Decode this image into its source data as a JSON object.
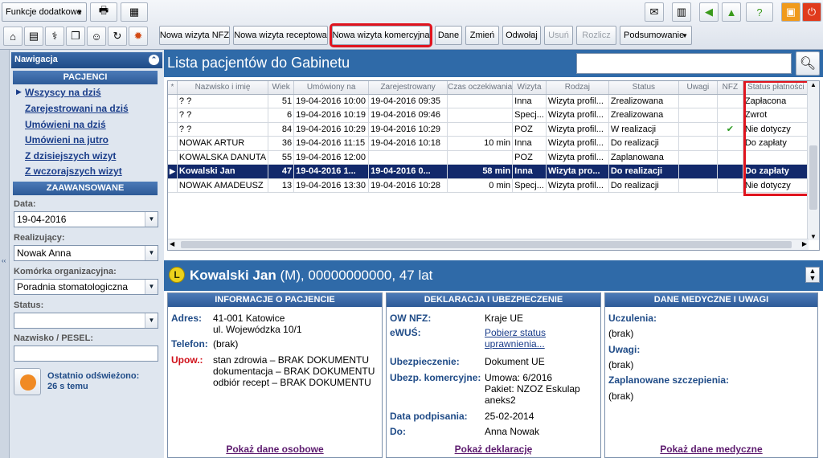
{
  "toolbar": {
    "dropdown_label": "Funkcje dodatkowe",
    "buttons": {
      "nowa_nfz": "Nowa wizyta NFZ",
      "nowa_receptowa": "Nowa wizyta receptowa",
      "nowa_komercyjna": "Nowa wizyta komercyjna",
      "dane": "Dane",
      "zmien": "Zmień",
      "odwolaj": "Odwołaj",
      "usun": "Usuń",
      "rozlicz": "Rozlicz",
      "podsumowanie": "Podsumowanie"
    }
  },
  "nav": {
    "title": "Nawigacja",
    "section_patients": "PACJENCI",
    "links": [
      "Wszyscy na dziś",
      "Zarejestrowani na dziś",
      "Umówieni na dziś",
      "Umówieni na jutro",
      "Z dzisiejszych wizyt",
      "Z wczorajszych wizyt"
    ],
    "section_advanced": "ZAAWANSOWANE",
    "date_label": "Data:",
    "date_value": "19-04-2016",
    "realizer_label": "Realizujący:",
    "realizer_value": "Nowak Anna",
    "unit_label": "Komórka organizacyjna:",
    "unit_value": "Poradnia stomatologiczna",
    "status_label": "Status:",
    "status_value": "",
    "name_label": "Nazwisko / PESEL:",
    "name_value": "",
    "refresh_line1": "Ostatnio odświeżono:",
    "refresh_line2": "26 s temu"
  },
  "list": {
    "title": "Lista pacjentów do Gabinetu",
    "columns": [
      "Nazwisko i imię",
      "Wiek",
      "Umówiony na",
      "Zarejestrowany",
      "Czas oczekiwania",
      "Wizyta",
      "Rodzaj",
      "Status",
      "Uwagi",
      "NFZ",
      "Status płatności"
    ],
    "rows": [
      {
        "name": "? ?",
        "age": "51",
        "appt": "19-04-2016 10:00",
        "reg": "19-04-2016 09:35",
        "wait": "",
        "visit": "Inna",
        "kind": "Wizyta profil...",
        "status": "Zrealizowana",
        "notes": "",
        "nfz": "",
        "pay": "Zapłacona"
      },
      {
        "name": "? ?",
        "age": "6",
        "appt": "19-04-2016 10:19",
        "reg": "19-04-2016 09:46",
        "wait": "",
        "visit": "Specj...",
        "kind": "Wizyta profil...",
        "status": "Zrealizowana",
        "notes": "",
        "nfz": "",
        "pay": "Zwrot"
      },
      {
        "name": "? ?",
        "age": "84",
        "appt": "19-04-2016 10:29",
        "reg": "19-04-2016 10:29",
        "wait": "",
        "visit": "POZ",
        "kind": "Wizyta profil...",
        "status": "W realizacji",
        "notes": "",
        "nfz": "✔",
        "pay": "Nie dotyczy"
      },
      {
        "name": "NOWAK ARTUR",
        "age": "36",
        "appt": "19-04-2016 11:15",
        "reg": "19-04-2016 10:18",
        "wait": "10 min",
        "visit": "Inna",
        "kind": "Wizyta profil...",
        "status": "Do realizacji",
        "notes": "",
        "nfz": "",
        "pay": "Do zapłaty"
      },
      {
        "name": "KOWALSKA DANUTA",
        "age": "55",
        "appt": "19-04-2016 12:00",
        "reg": "",
        "wait": "",
        "visit": "POZ",
        "kind": "Wizyta profil...",
        "status": "Zaplanowana",
        "notes": "",
        "nfz": "",
        "pay": ""
      },
      {
        "name": "Kowalski Jan",
        "age": "47",
        "appt": "19-04-2016 1...",
        "reg": "19-04-2016 0...",
        "wait": "58 min",
        "visit": "Inna",
        "kind": "Wizyta pro...",
        "status": "Do realizacji",
        "notes": "",
        "nfz": "",
        "pay": "Do zapłaty"
      },
      {
        "name": "NOWAK AMADEUSZ",
        "age": "13",
        "appt": "19-04-2016 13:30",
        "reg": "19-04-2016 10:28",
        "wait": "0 min",
        "visit": "Specj...",
        "kind": "Wizyta profil...",
        "status": "Do realizacji",
        "notes": "",
        "nfz": "",
        "pay": "Nie dotyczy"
      }
    ]
  },
  "patient": {
    "badge": "L",
    "name": "Kowalski Jan",
    "details": " (M), 00000000000, 47 lat"
  },
  "info": {
    "title": "INFORMACJE O PACJENCIE",
    "address_label": "Adres:",
    "address1": "41-001 Katowice",
    "address2": "ul. Wojewódzka 10/1",
    "phone_label": "Telefon:",
    "phone_value": "(brak)",
    "upow_label": "Upow.:",
    "upow1": "stan zdrowia – BRAK DOKUMENTU",
    "upow2": "dokumentacja – BRAK DOKUMENTU",
    "upow3": "odbiór recept – BRAK DOKUMENTU",
    "link": "Pokaż dane osobowe"
  },
  "decl": {
    "title": "DEKLARACJA I UBEZPIECZENIE",
    "ow_label": "OW NFZ:",
    "ow_value": "Kraje UE",
    "ewus_label": "eWUŚ:",
    "ewus_link1": "Pobierz status",
    "ewus_link2": "uprawnienia...",
    "ubez_label": "Ubezpieczenie:",
    "ubez_value": "Dokument UE",
    "kom_label": "Ubezp. komercyjne:",
    "kom1": "Umowa: 6/2016",
    "kom2": "Pakiet: NZOZ Eskulap",
    "kom3": "aneks2",
    "date_label": "Data podpisania:",
    "date_value": "25-02-2014",
    "do_label": "Do:",
    "do_value": "Anna Nowak",
    "link": "Pokaż deklarację"
  },
  "med": {
    "title": "DANE MEDYCZNE I UWAGI",
    "allergy_label": "Uczulenia:",
    "allergy_value": "(brak)",
    "notes_label": "Uwagi:",
    "notes_value": "(brak)",
    "vacc_label": "Zaplanowane szczepienia:",
    "vacc_value": "(brak)",
    "link": "Pokaż dane medyczne"
  },
  "colors": {
    "header_blue": "#2f6aa8",
    "highlight_red": "#e0141e",
    "selected_row": "#12296b"
  }
}
